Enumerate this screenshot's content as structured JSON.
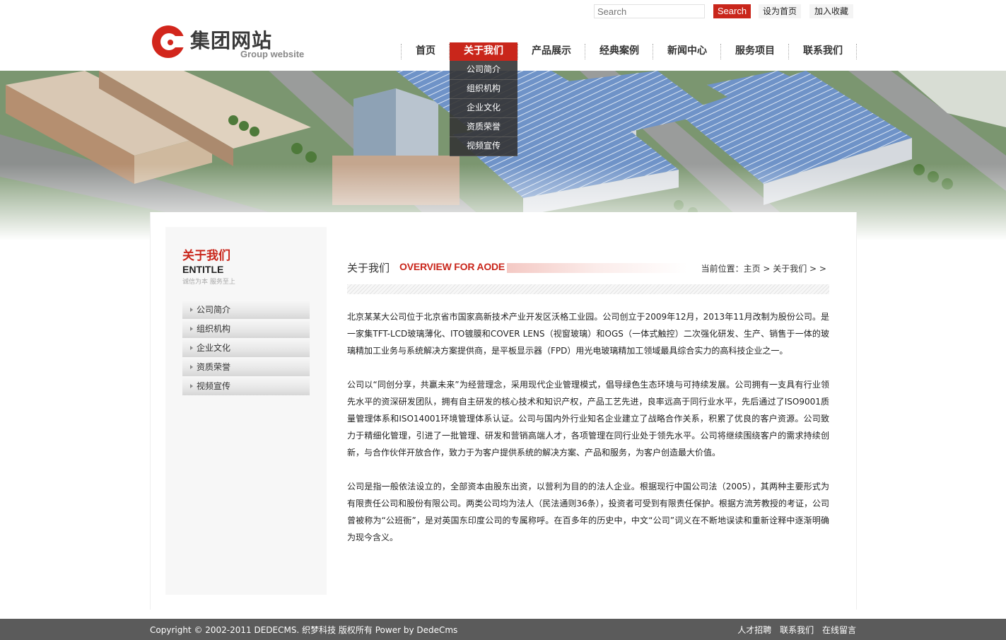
{
  "header": {
    "logo_cn": "集团网站",
    "logo_en": "Group website",
    "search_placeholder": "Search",
    "search_button": "Search",
    "set_home": "设为首页",
    "add_favorite": "加入收藏"
  },
  "nav": {
    "items": [
      "首页",
      "关于我们",
      "产品展示",
      "经典案例",
      "新闻中心",
      "服务项目",
      "联系我们"
    ],
    "active": "关于我们",
    "dropdown": [
      "公司简介",
      "组织机构",
      "企业文化",
      "资质荣誉",
      "视频宣传"
    ]
  },
  "sidebar": {
    "title_cn": "关于我们",
    "title_en": "ENTITLE",
    "slogan": "诚信为本 服务至上",
    "items": [
      "公司简介",
      "组织机构",
      "企业文化",
      "资质荣誉",
      "视频宣传"
    ]
  },
  "content": {
    "title_cn": "关于我们",
    "title_en": "OVERVIEW FOR AODE",
    "breadcrumb": "当前位置：主页 > 关于我们 > >",
    "paragraphs": [
      "北京某某大公司位于北京省市国家高新技术产业开发区沃格工业园。公司创立于2009年12月，2013年11月改制为股份公司。是一家集TFT-LCD玻璃薄化、ITO镀膜和COVER LENS（视窗玻璃）和OGS（一体式触控）二次强化研发、生产、销售于一体的玻璃精加工业务与系统解决方案提供商，是平板显示器（FPD）用光电玻璃精加工领域最具综合实力的高科技企业之一。",
      "公司以“同创分享，共赢未来”为经营理念，采用现代企业管理模式，倡导绿色生态环境与可持续发展。公司拥有一支具有行业领先水平的资深研发团队，拥有自主研发的核心技术和知识产权，产品工艺先进，良率远高于同行业水平，先后通过了ISO9001质量管理体系和ISO14001环境管理体系认证。公司与国内外行业知名企业建立了战略合作关系，积累了优良的客户资源。公司致力于精细化管理，引进了一批管理、研发和营销高端人才，各项管理在同行业处于领先水平。公司将继续围绕客户的需求持续创新，与合作伙伴开放合作，致力于为客户提供系统的解决方案、产品和服务，为客户创造最大价值。",
      "公司是指一般依法设立的，全部资本由股东出资，以营利为目的的法人企业。根据现行中国公司法（2005），其两种主要形式为有限责任公司和股份有限公司。两类公司均为法人（民法通则36条），投资者可受到有限责任保护。根据方流芳教授的考证，公司曾被称为“公班衙”，是对英国东印度公司的专属称呼。在百多年的历史中，中文“公司”词义在不断地误读和重新诠释中逐渐明确为现今含义。"
    ]
  },
  "footer": {
    "copyright": "Copyright © 2002-2011 DEDECMS. 织梦科技 版权所有 Power by DedeCms",
    "links": [
      "人才招聘",
      "联系我们",
      "在线留言"
    ]
  },
  "colors": {
    "accent": "#c9261b",
    "footer_bg": "#5b5b5b",
    "dropdown_bg": "#343434"
  }
}
